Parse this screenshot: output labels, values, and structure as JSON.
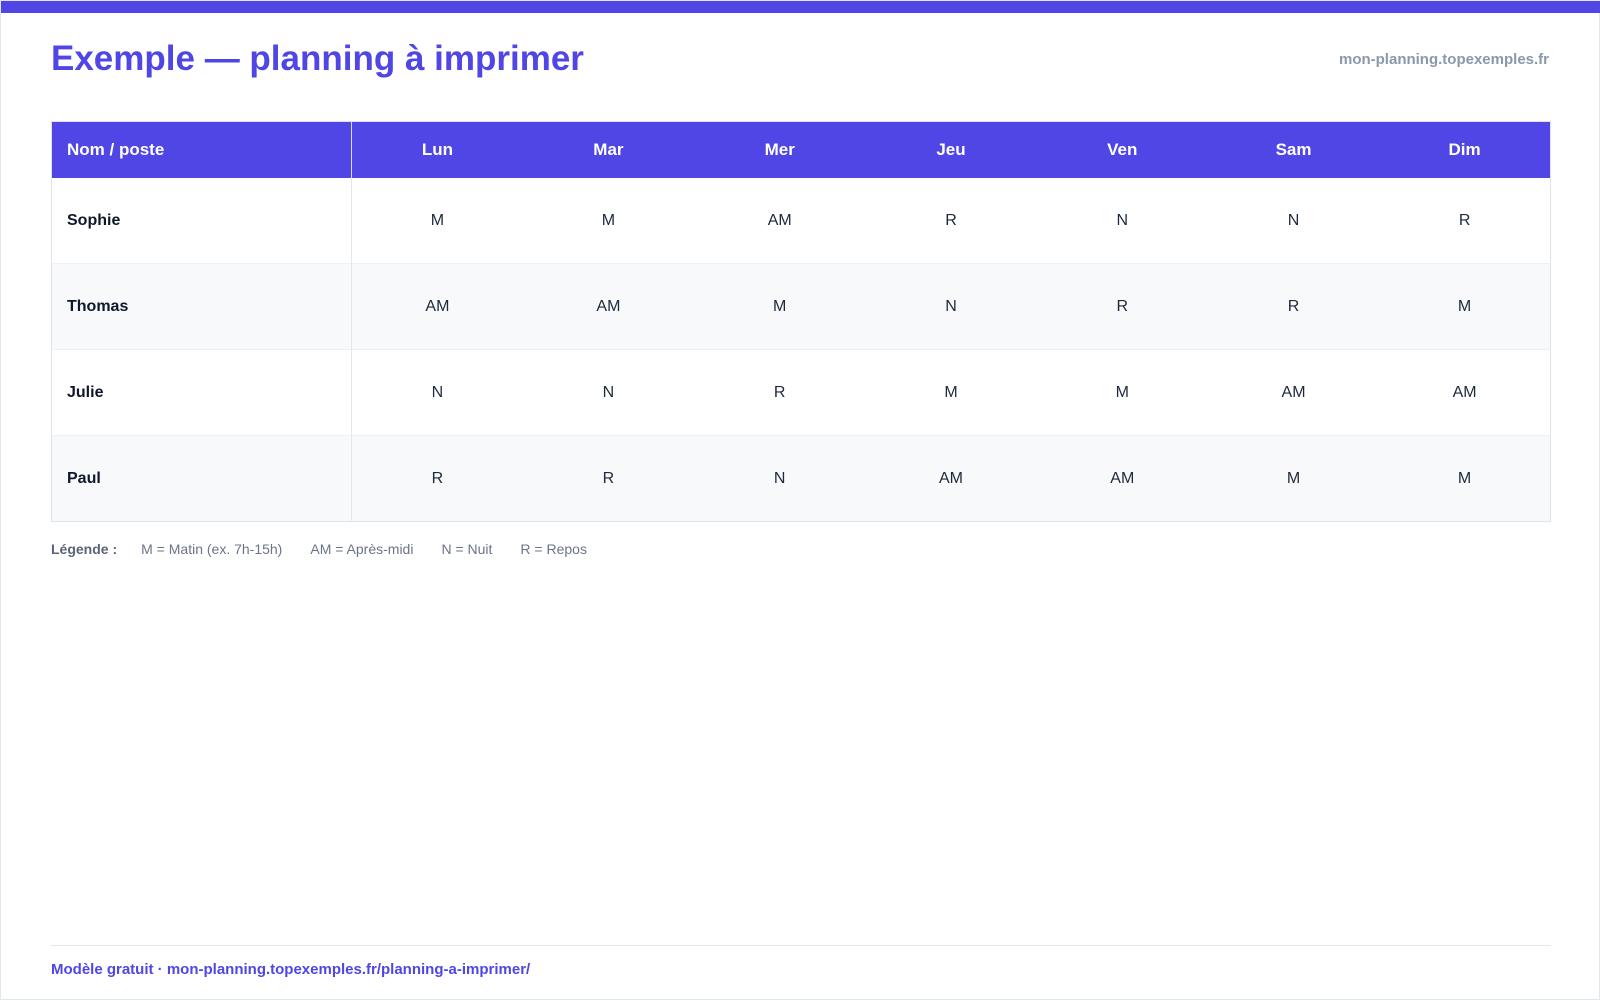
{
  "colors": {
    "accent": "#4f46e5",
    "muted": "#8a97ad",
    "row_alt": "#f7f9fb"
  },
  "header": {
    "title": "Exemple — planning à imprimer",
    "site": "mon-planning.topexemples.fr"
  },
  "table": {
    "name_header": "Nom / poste",
    "days": [
      "Lun",
      "Mar",
      "Mer",
      "Jeu",
      "Ven",
      "Sam",
      "Dim"
    ],
    "rows": [
      {
        "name": "Sophie",
        "shifts": [
          "M",
          "M",
          "AM",
          "R",
          "N",
          "N",
          "R"
        ]
      },
      {
        "name": "Thomas",
        "shifts": [
          "AM",
          "AM",
          "M",
          "N",
          "R",
          "R",
          "M"
        ]
      },
      {
        "name": "Julie",
        "shifts": [
          "N",
          "N",
          "R",
          "M",
          "M",
          "AM",
          "AM"
        ]
      },
      {
        "name": "Paul",
        "shifts": [
          "R",
          "R",
          "N",
          "AM",
          "AM",
          "M",
          "M"
        ]
      }
    ]
  },
  "legend": {
    "title": "Légende :",
    "items": [
      "M = Matin (ex. 7h-15h)",
      "AM = Après-midi",
      "N = Nuit",
      "R = Repos"
    ]
  },
  "footer": {
    "text": "Modèle gratuit · mon-planning.topexemples.fr/planning-a-imprimer/"
  }
}
